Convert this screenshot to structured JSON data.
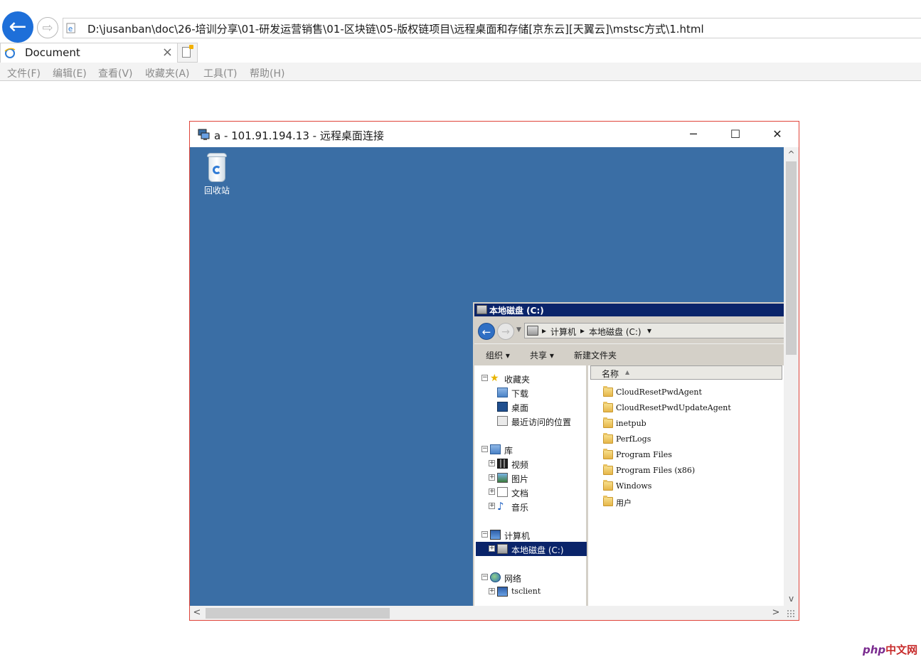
{
  "browser": {
    "address": "D:\\jusanban\\doc\\26-培训分享\\01-研发运营销售\\01-区块链\\05-版权链项目\\远程桌面和存储[京东云][天翼云]\\mstsc方式\\1.html",
    "tab_title": "Document",
    "menu": [
      "文件(F)",
      "编辑(E)",
      "查看(V)",
      "收藏夹(A)",
      "工具(T)",
      "帮助(H)"
    ],
    "icons": {
      "back": "back-arrow-icon",
      "forward": "forward-arrow-icon",
      "favicon": "ie-page-icon",
      "close": "close-icon",
      "newtab": "new-tab-icon"
    }
  },
  "rdp": {
    "title": "a - 101.91.194.13 - 远程桌面连接",
    "controls": {
      "minimize": "─",
      "maximize": "☐",
      "close": "✕"
    },
    "scroll": {
      "up": "^",
      "down": "v",
      "left": "<",
      "right": ">"
    }
  },
  "desktop": {
    "background": "#3a6ea5",
    "recycle_bin_label": "回收站"
  },
  "explorer": {
    "window_title": "本地磁盘 (C:)",
    "breadcrumb": [
      "计算机",
      "本地磁盘 (C:)"
    ],
    "toolbar": [
      "组织 ▾",
      "共享 ▾",
      "新建文件夹"
    ],
    "tree": {
      "favorites": {
        "label": "收藏夹",
        "items": [
          "下载",
          "桌面",
          "最近访问的位置"
        ]
      },
      "libraries": {
        "label": "库",
        "items": [
          "视频",
          "图片",
          "文档",
          "音乐"
        ]
      },
      "computer": {
        "label": "计算机",
        "items": [
          "本地磁盘 (C:)"
        ]
      },
      "network": {
        "label": "网络",
        "items": [
          "tsclient"
        ]
      }
    },
    "column_header": "名称",
    "files": [
      "CloudResetPwdAgent",
      "CloudResetPwdUpdateAgent",
      "inetpub",
      "PerfLogs",
      "Program Files",
      "Program Files (x86)",
      "Windows",
      "用户"
    ],
    "selected_color": "#0a246a"
  },
  "watermark": {
    "brand": "php",
    "text": "中文网"
  }
}
